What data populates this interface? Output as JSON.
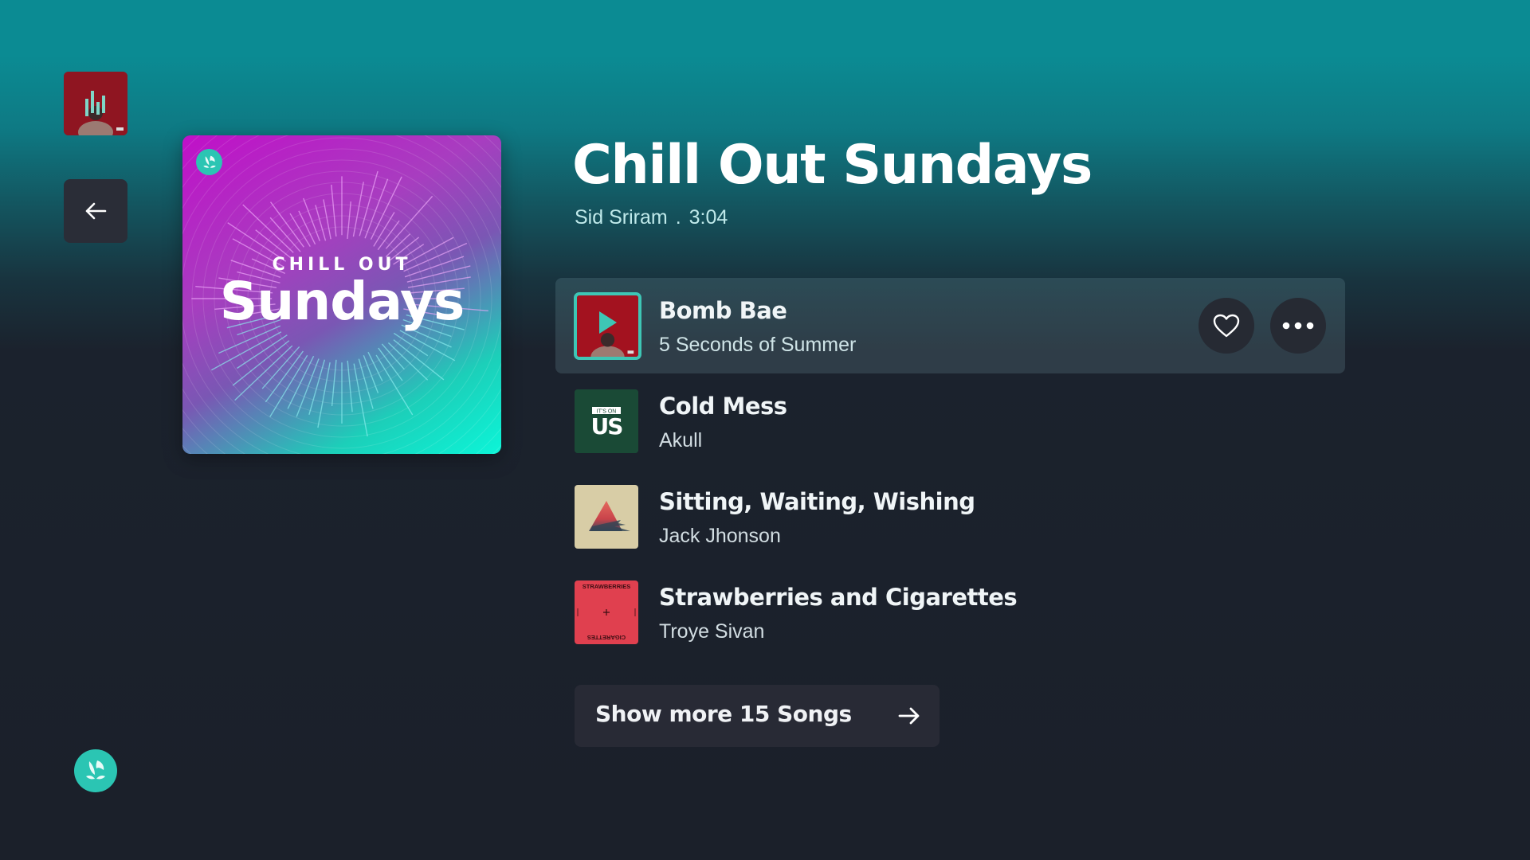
{
  "rail": {
    "now_playing_thumb": "now-playing-artwork",
    "back_icon": "arrow-left-icon",
    "brand_icon": "jiosaavn-logo-icon"
  },
  "playlist": {
    "cover_kicker": "CHILL OUT",
    "cover_title": "Sundays",
    "title": "Chill Out Sundays",
    "artist": "Sid Sriram",
    "separator": ".",
    "duration": "3:04"
  },
  "tracks": [
    {
      "title": "Bomb Bae",
      "artist": "5 Seconds of Summer",
      "active": true,
      "art": "red-figure",
      "overlay_icon": "play-icon"
    },
    {
      "title": "Cold Mess",
      "artist": "Akull",
      "active": false,
      "art": "its-on-us",
      "art_kicker": "IT'S ON",
      "art_word": "US"
    },
    {
      "title": "Sitting, Waiting, Wishing",
      "artist": "Jack Jhonson",
      "active": false,
      "art": "triangle"
    },
    {
      "title": "Strawberries and Cigarettes",
      "artist": "Troye Sivan",
      "active": false,
      "art": "strawberries",
      "art_top": "STRAWBERRIES",
      "art_bottom": "CIGARETTES"
    }
  ],
  "actions": {
    "like_icon": "heart-icon",
    "more_icon": "more-horizontal-icon"
  },
  "show_more": {
    "label": "Show more 15 Songs",
    "icon": "arrow-right-icon"
  },
  "colors": {
    "accent": "#2bc5b3",
    "bg_top": "#0b8b93",
    "bg_bottom": "#1b202a",
    "button_bg": "#2a2d37"
  }
}
